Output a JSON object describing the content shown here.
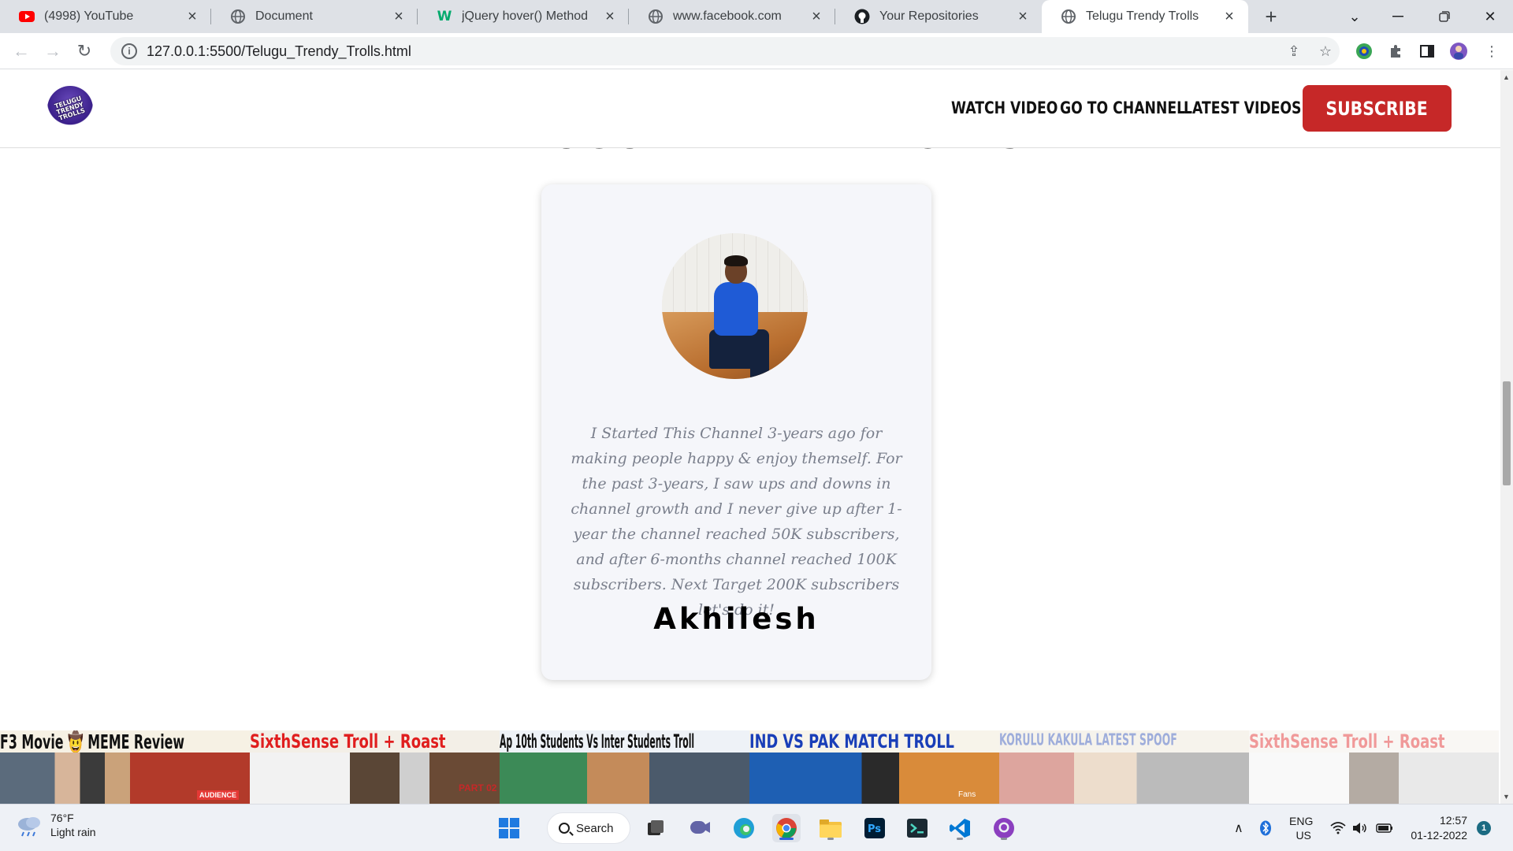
{
  "browser": {
    "tabs": [
      {
        "title": "(4998) YouTube",
        "icon": "youtube-icon"
      },
      {
        "title": "Document",
        "icon": "globe-icon"
      },
      {
        "title": "jQuery hover() Method",
        "icon": "w3schools-icon"
      },
      {
        "title": "www.facebook.com",
        "icon": "globe-icon"
      },
      {
        "title": "Your Repositories",
        "icon": "github-icon"
      },
      {
        "title": "Telugu Trendy Trolls",
        "icon": "globe-icon",
        "active": true
      }
    ],
    "url": "127.0.0.1:5500/Telugu_Trendy_Trolls.html"
  },
  "site": {
    "logo_text": "TELUGU TRENDY TROLLS",
    "nav": {
      "watch": "WATCH VIDEO",
      "channel": "GO TO CHANNEL",
      "latest": "LATEST VIDEOS",
      "subscribe": "SUBSCRIBE"
    },
    "section_heading": "TELUGU TRENDY TROLLS",
    "testimonial": {
      "quote": "I Started This Channel 3-years ago for making people happy & enjoy themself. For the past 3-years, I saw ups and downs in channel growth and I never give up after 1-year the channel reached 50K subscribers, and after 6-months channel reached 100K subscribers. Next Target 200K subscribers let's do it!",
      "name": "Akhilesh"
    },
    "thumbnails": [
      {
        "caption": "F3 Movie 🤠 MEME Review",
        "badge": "AUDIENCE"
      },
      {
        "caption": "SixthSense Troll + Roast",
        "badge": "PART 02"
      },
      {
        "caption": "Ap 10th Students Vs Inter Students Troll",
        "badge": ""
      },
      {
        "caption": "IND VS PAK MATCH TROLL",
        "badge": "Fans"
      },
      {
        "caption": "KORULU KAKULA LATEST SPOOF",
        "badge": ""
      },
      {
        "caption": "SixthSense Troll + Roast",
        "badge": ""
      }
    ]
  },
  "taskbar": {
    "weather_temp": "76°F",
    "weather_cond": "Light rain",
    "search": "Search",
    "lang1": "ENG",
    "lang2": "US",
    "time": "12:57",
    "date": "01-12-2022",
    "notif_count": "1"
  },
  "colors": {
    "accent": "#c62828",
    "card_bg": "#f5f6fa",
    "quote_text": "#7a7f8c"
  }
}
